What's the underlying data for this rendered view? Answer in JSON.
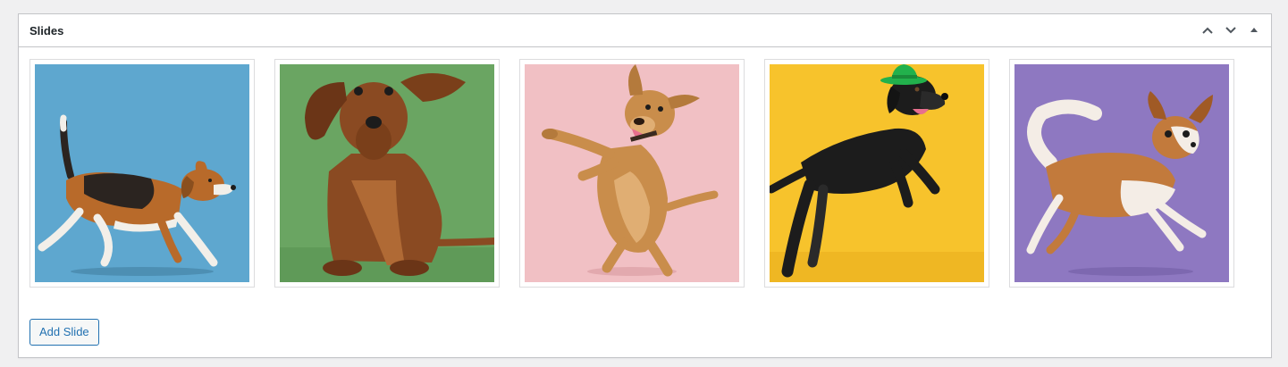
{
  "metabox": {
    "title": "Slides",
    "controls": [
      {
        "icon": "chevron-up-icon"
      },
      {
        "icon": "chevron-down-icon"
      },
      {
        "icon": "triangle-up-icon"
      }
    ]
  },
  "slides": [
    {
      "subject": "beagle-running",
      "background": "#5ea7cf",
      "dog_colors": [
        "#b86a2a",
        "#2b2420",
        "#f2efe9"
      ]
    },
    {
      "subject": "dachshund-sitting",
      "background": "#6aa562",
      "dog_colors": [
        "#8a4a22",
        "#6b3517",
        "#b06a35"
      ]
    },
    {
      "subject": "labrador-mix-dancing",
      "background": "#f1c0c4",
      "dog_colors": [
        "#c98d4b",
        "#e0ae73",
        "#7a4a25"
      ]
    },
    {
      "subject": "black-lab-jumping-with-hat",
      "background": "#f7c32c",
      "dog_colors": [
        "#1c1c1c",
        "#2a2a2a",
        "#22b14c"
      ]
    },
    {
      "subject": "chihuahua-running",
      "background": "#8e78c1",
      "dog_colors": [
        "#c27a3c",
        "#f4ede6",
        "#a05a25"
      ]
    }
  ],
  "add_button": {
    "label": "Add Slide"
  }
}
